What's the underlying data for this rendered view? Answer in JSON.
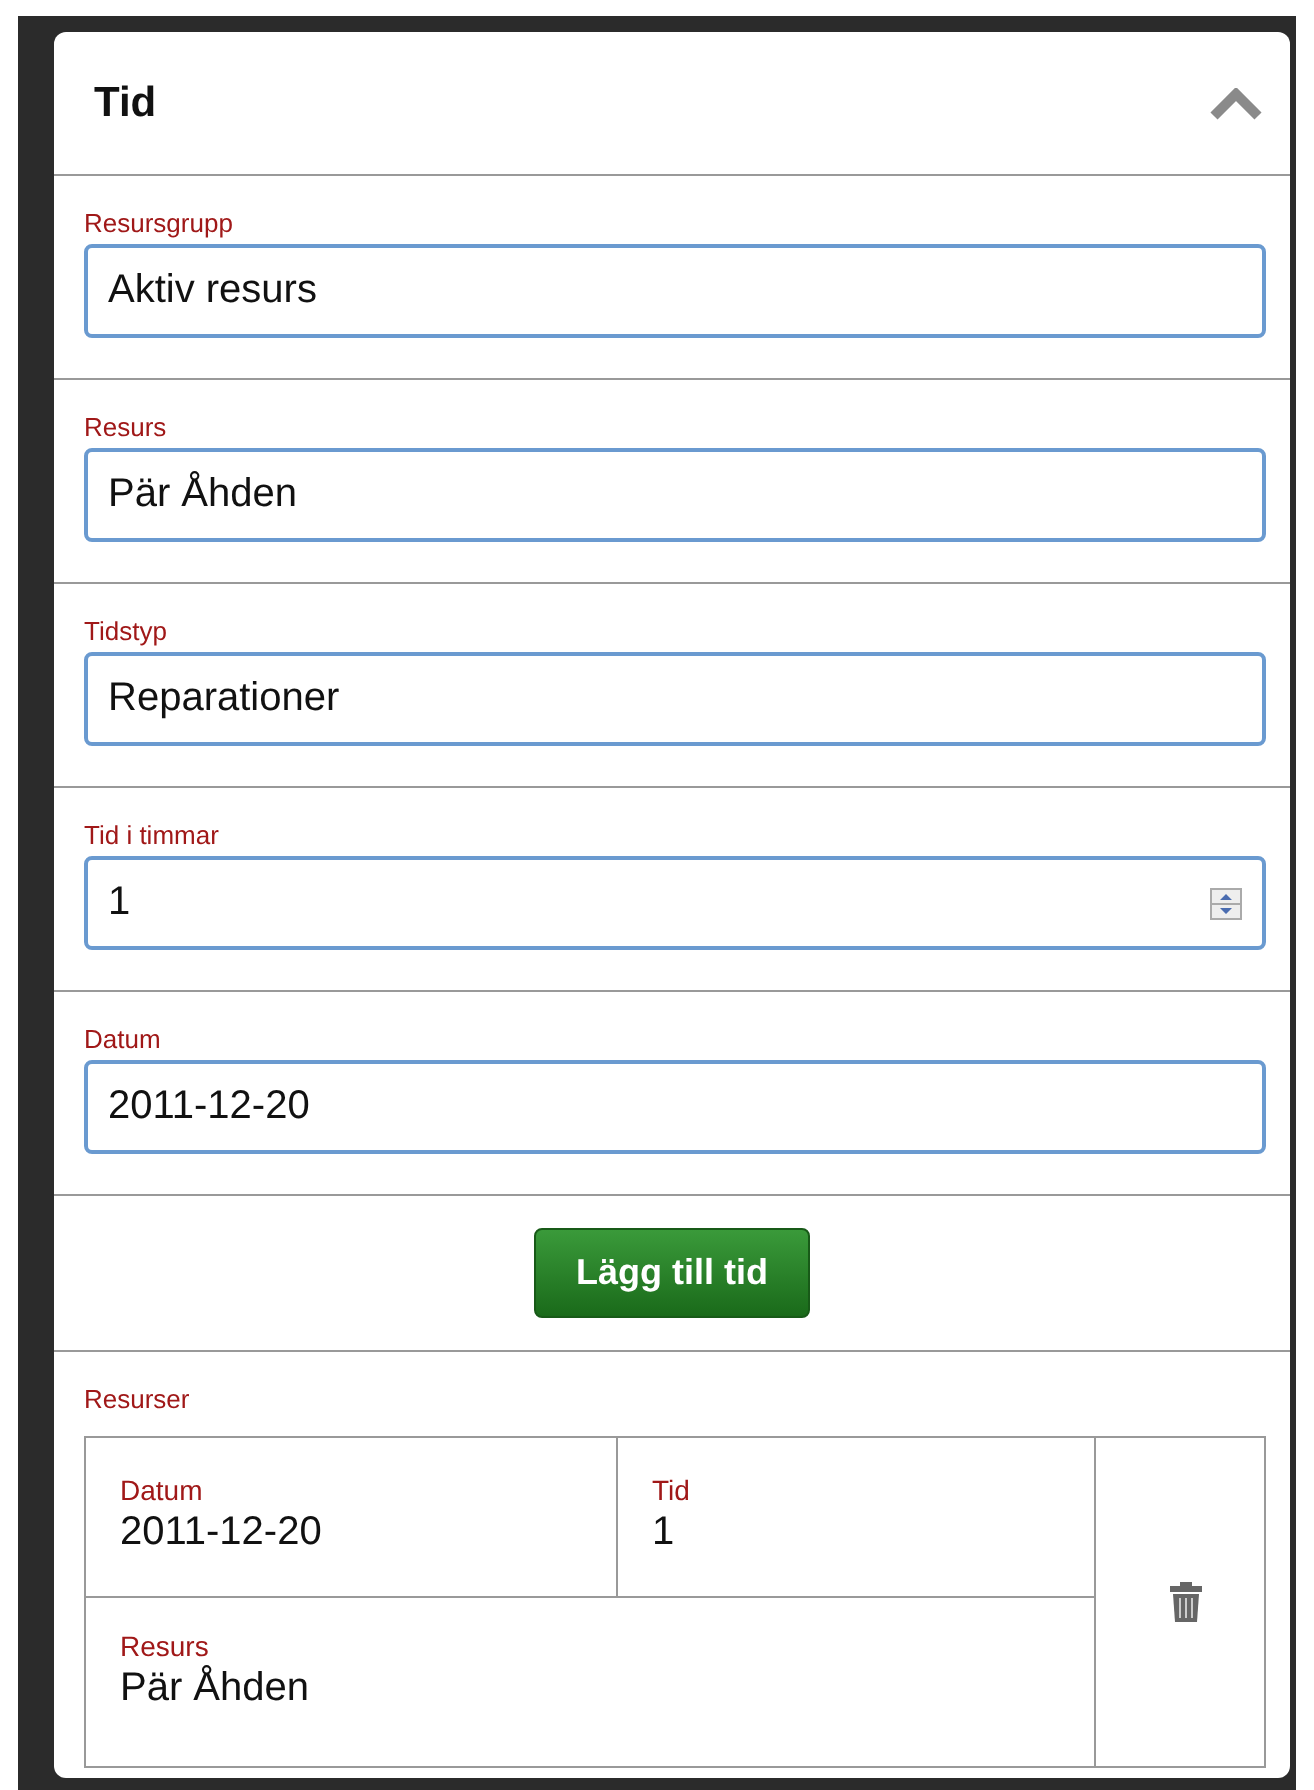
{
  "panel": {
    "title": "Tid",
    "expanded": true
  },
  "fields": [
    {
      "label": "Resursgrupp",
      "value": "Aktiv resurs",
      "kind": "text"
    },
    {
      "label": "Resurs",
      "value": "Pär Åhden",
      "kind": "text"
    },
    {
      "label": "Tidstyp",
      "value": "Reparationer",
      "kind": "text"
    },
    {
      "label": "Tid i timmar",
      "value": "1",
      "kind": "number"
    },
    {
      "label": "Datum",
      "value": "2011-12-20",
      "kind": "text"
    }
  ],
  "add_button": "Lägg till tid",
  "resources": {
    "label": "Resurser",
    "rows": [
      {
        "date_label": "Datum",
        "date": "2011-12-20",
        "time_label": "Tid",
        "time": "1",
        "resource_label": "Resurs",
        "resource": "Pär Åhden"
      }
    ]
  }
}
